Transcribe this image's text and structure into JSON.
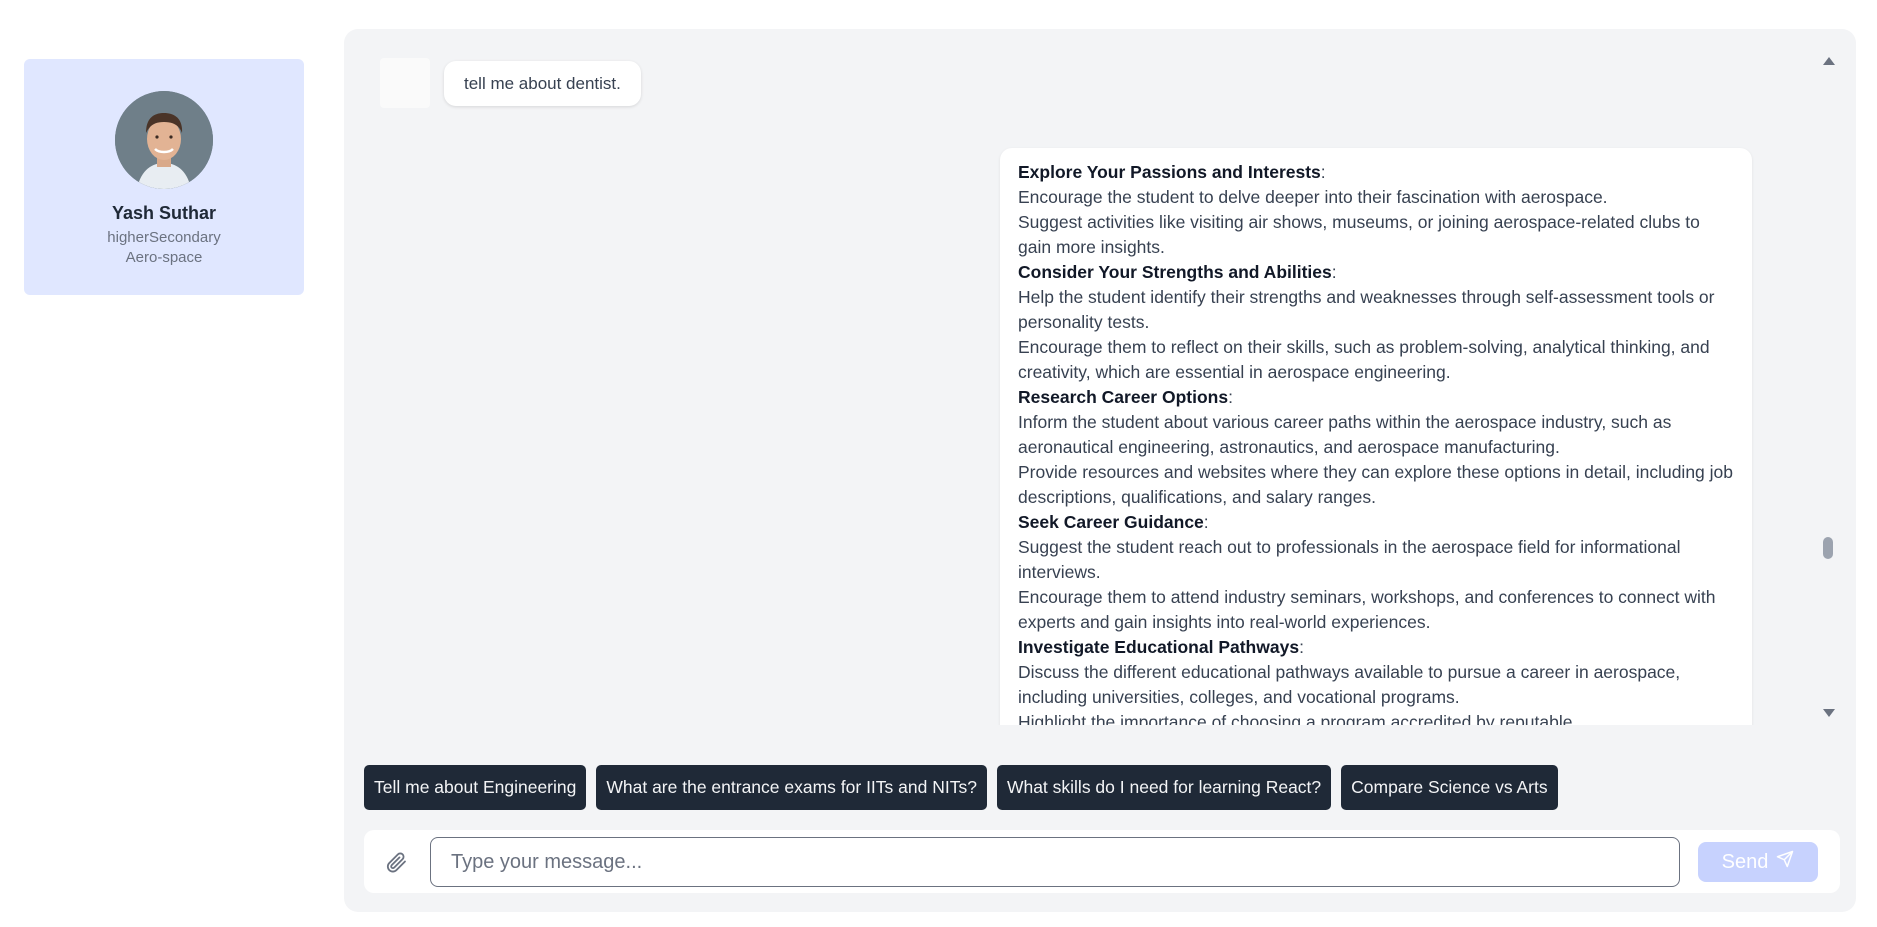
{
  "profile": {
    "name": "Yash Suthar",
    "level": "higherSecondary",
    "interest": "Aero-space"
  },
  "conversation": {
    "user_message": "tell me about dentist.",
    "bot_sections": [
      {
        "heading": "Explore Your Passions and Interests",
        "lines": [
          "Encourage the student to delve deeper into their fascination with aerospace.",
          "Suggest activities like visiting air shows, museums, or joining aerospace-related clubs to gain more insights."
        ]
      },
      {
        "heading": "Consider Your Strengths and Abilities",
        "lines": [
          "Help the student identify their strengths and weaknesses through self-assessment tools or personality tests.",
          "Encourage them to reflect on their skills, such as problem-solving, analytical thinking, and creativity, which are essential in aerospace engineering."
        ]
      },
      {
        "heading": "Research Career Options",
        "lines": [
          "Inform the student about various career paths within the aerospace industry, such as aeronautical engineering, astronautics, and aerospace manufacturing.",
          "Provide resources and websites where they can explore these options in detail, including job descriptions, qualifications, and salary ranges."
        ]
      },
      {
        "heading": "Seek Career Guidance",
        "lines": [
          "Suggest the student reach out to professionals in the aerospace field for informational interviews.",
          "Encourage them to attend industry seminars, workshops, and conferences to connect with experts and gain insights into real-world experiences."
        ]
      },
      {
        "heading": "Investigate Educational Pathways",
        "lines": [
          "Discuss the different educational pathways available to pursue a career in aerospace, including universities, colleges, and vocational programs.",
          "Highlight the importance of choosing a program accredited by reputable"
        ]
      }
    ]
  },
  "suggestions": [
    "Tell me about Engineering",
    "What are the entrance exams for IITs and NITs?",
    "What skills do I need for learning React?",
    "Compare Science vs Arts"
  ],
  "composer": {
    "placeholder": "Type your message...",
    "value": "",
    "send_label": "Send",
    "attach_icon": "paperclip-icon",
    "send_icon": "paper-plane-icon"
  },
  "colors": {
    "profile_bg": "#e0e7ff",
    "panel_bg": "#f3f4f6",
    "chip_bg": "#1f2937",
    "send_bg": "#c7d2fe"
  }
}
